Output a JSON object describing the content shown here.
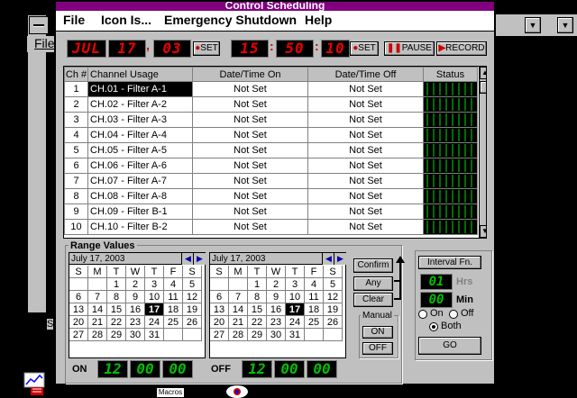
{
  "window": {
    "title": "Control Scheduling"
  },
  "menu": [
    {
      "label": "File",
      "accel": "F"
    },
    {
      "label": "Icon Is...",
      "accel": "I"
    },
    {
      "label": "Emergency Shutdown",
      "accel": "E"
    },
    {
      "label": "Help",
      "accel": "H"
    }
  ],
  "background": {
    "menu_label": "File",
    "side_label": "S"
  },
  "toolbar": {
    "month": "JUL",
    "day": "17",
    "year": "03",
    "date_set": "SET",
    "hour": "15",
    "minute": "50",
    "second": "10",
    "time_set": "SET",
    "pause": "PAUSE",
    "record": "RECORD"
  },
  "grid": {
    "headers": [
      "Ch #",
      "Channel Usage",
      "Date/Time On",
      "Date/Time Off",
      "Status"
    ],
    "rows": [
      {
        "num": "1",
        "usage": "CH.01 - Filter A-1",
        "on": "Not Set",
        "off": "Not Set"
      },
      {
        "num": "2",
        "usage": "CH.02 - Filter A-2",
        "on": "Not Set",
        "off": "Not Set"
      },
      {
        "num": "3",
        "usage": "CH.03 - Filter A-3",
        "on": "Not Set",
        "off": "Not Set"
      },
      {
        "num": "4",
        "usage": "CH.04 - Filter A-4",
        "on": "Not Set",
        "off": "Not Set"
      },
      {
        "num": "5",
        "usage": "CH.05 - Filter A-5",
        "on": "Not Set",
        "off": "Not Set"
      },
      {
        "num": "6",
        "usage": "CH.06 - Filter A-6",
        "on": "Not Set",
        "off": "Not Set"
      },
      {
        "num": "7",
        "usage": "CH.07 - Filter A-7",
        "on": "Not Set",
        "off": "Not Set"
      },
      {
        "num": "8",
        "usage": "CH.08 - Filter A-8",
        "on": "Not Set",
        "off": "Not Set"
      },
      {
        "num": "9",
        "usage": "CH.09 - Filter B-1",
        "on": "Not Set",
        "off": "Not Set"
      },
      {
        "num": "10",
        "usage": "CH.10 - Filter B-2",
        "on": "Not Set",
        "off": "Not Set"
      }
    ],
    "selected_row": 0
  },
  "range": {
    "title": "Range Values",
    "calendars": [
      {
        "header": "July 17, 2003"
      },
      {
        "header": "July 17, 2003"
      }
    ],
    "weekdays": [
      "S",
      "M",
      "T",
      "W",
      "T",
      "F",
      "S"
    ],
    "weeks": [
      [
        "",
        "",
        "1",
        "2",
        "3",
        "4",
        "5"
      ],
      [
        "6",
        "7",
        "8",
        "9",
        "10",
        "11",
        "12"
      ],
      [
        "13",
        "14",
        "15",
        "16",
        "17",
        "18",
        "19"
      ],
      [
        "20",
        "21",
        "22",
        "23",
        "24",
        "25",
        "26"
      ],
      [
        "27",
        "28",
        "29",
        "30",
        "31",
        "",
        ""
      ]
    ],
    "highlight_day": "17",
    "on_label": "ON",
    "off_label": "OFF",
    "on_time": [
      "12",
      "00",
      "00"
    ],
    "off_time": [
      "12",
      "00",
      "00"
    ]
  },
  "actions": {
    "confirm": "Confirm",
    "any": "Any",
    "clear": "Clear"
  },
  "manual": {
    "title": "Manual",
    "on": "ON",
    "off": "OFF"
  },
  "interval": {
    "title": "Interval Fn.",
    "hrs_value": "01",
    "hrs_label": "Hrs",
    "min_value": "00",
    "min_label": "Min",
    "opt_on": "On",
    "opt_off": "Off",
    "opt_both": "Both",
    "selected": "Both",
    "go": "GO"
  },
  "desktop": {
    "icon_label": "Macros"
  }
}
